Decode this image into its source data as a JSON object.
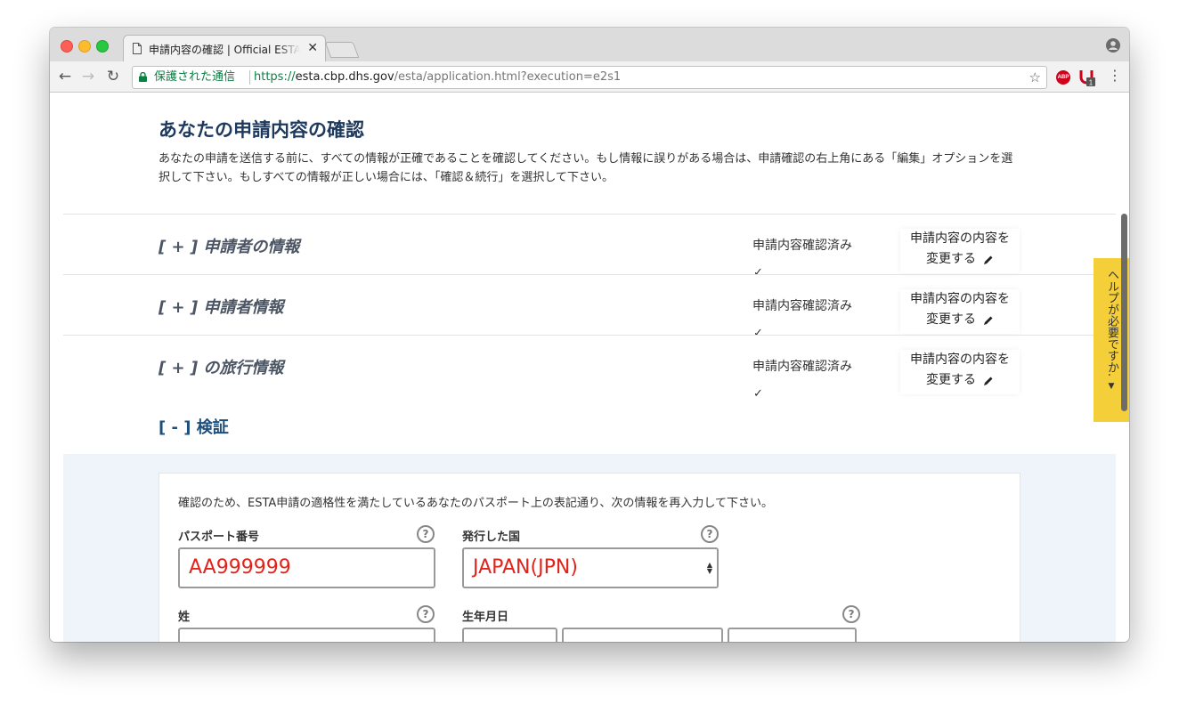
{
  "browser": {
    "tab_title": "申請内容の確認 | Official ESTA Application Website",
    "tab_close": "✕",
    "secure_label": "保護された通信",
    "url_scheme": "https://",
    "url_host": "esta.cbp.dhs.gov",
    "url_path": "/esta/application.html?execution=e2s1",
    "bookmark_icon": "☆",
    "abp_label": "ABP",
    "ext_badge": "1",
    "menu_icon": "⋮"
  },
  "page": {
    "title": "あなたの申請内容の確認",
    "intro": "あなたの申請を送信する前に、すべての情報が正確であることを確認してください。もし情報に誤りがある場合は、申請確認の右上角にある「編集」オプションを選択して下さい。もしすべての情報が正しい場合には、「確認＆続行」を選択して下さい。"
  },
  "sections": [
    {
      "title": "[ + ] 申請者の情報",
      "status": "申請内容確認済み",
      "check": "✓",
      "edit_line1": "申請内容の内容を",
      "edit_line2": "変更する"
    },
    {
      "title": "[ + ] 申請者情報",
      "status": "申請内容確認済み",
      "check": "✓",
      "edit_line1": "申請内容の内容を",
      "edit_line2": "変更する"
    },
    {
      "title": "[ + ] の旅行情報",
      "status": "申請内容確認済み",
      "check": "✓",
      "edit_line1": "申請内容の内容を",
      "edit_line2": "変更する"
    }
  ],
  "verify": {
    "heading": "[ - ] 検証",
    "instructions": "確認のため、ESTA申請の適格性を満たしているあなたのパスポート上の表記通り、次の情報を再入力して下さい。",
    "passport_label": "パスポート番号",
    "passport_value": "AA999999",
    "country_label": "発行した国",
    "country_value": "JAPAN(JPN)",
    "surname_label": "姓",
    "dob_label": "生年月日",
    "help_glyph": "?"
  },
  "help_tab": {
    "label": "ヘルプが必要ですか.",
    "arrow": "▼"
  },
  "colors": {
    "title_navy": "#1d3a5e",
    "secure_green": "#0b8043",
    "input_red": "#e0241b",
    "help_yellow": "#f4cf3a",
    "panel_blue": "#eff4fa"
  }
}
